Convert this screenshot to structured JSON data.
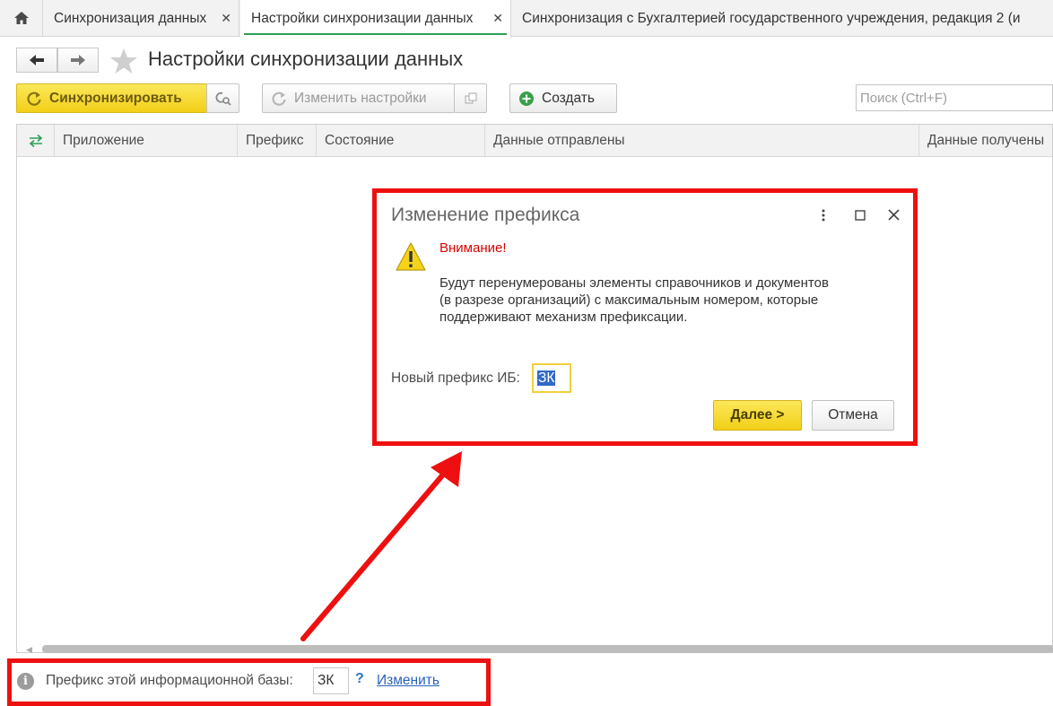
{
  "tabs": [
    {
      "label": "Синхронизация данных"
    },
    {
      "label": "Настройки синхронизации данных"
    },
    {
      "label": "Синхронизация с Бухгалтерией государственного учреждения, редакция 2 (и"
    }
  ],
  "page": {
    "title": "Настройки синхронизации данных"
  },
  "toolbar": {
    "sync_label": "Синхронизировать",
    "change_settings_label": "Изменить настройки",
    "create_label": "Создать",
    "search_placeholder": "Поиск (Ctrl+F)"
  },
  "table": {
    "columns": [
      "Приложение",
      "Префикс",
      "Состояние",
      "Данные отправлены",
      "Данные получены"
    ]
  },
  "dialog": {
    "title": "Изменение префикса",
    "warning_title": "Внимание!",
    "message_lines": [
      "Будут перенумерованы элементы справочников и документов",
      "(в разрезе организаций) с максимальным номером, которые",
      "поддерживают механизм префиксации."
    ],
    "prefix_label": "Новый префикс ИБ:",
    "prefix_value": "ЗК",
    "next_label": "Далее >",
    "cancel_label": "Отмена"
  },
  "footer": {
    "prefix_label": "Префикс этой информационной базы:",
    "prefix_value": "ЗК",
    "help": "?",
    "change_link": "Изменить"
  },
  "colors": {
    "highlight": "#ee1010",
    "accent_yellow": "#f2cf17",
    "accent_green": "#2f9e55"
  },
  "icons": [
    "home-icon",
    "close-icon",
    "back-arrow-icon",
    "forward-arrow-icon",
    "star-icon",
    "refresh-icon",
    "search-settings-icon",
    "copy-icon",
    "plus-icon",
    "sync-arrows-icon",
    "warning-icon",
    "more-icon",
    "maximize-icon",
    "info-icon"
  ]
}
